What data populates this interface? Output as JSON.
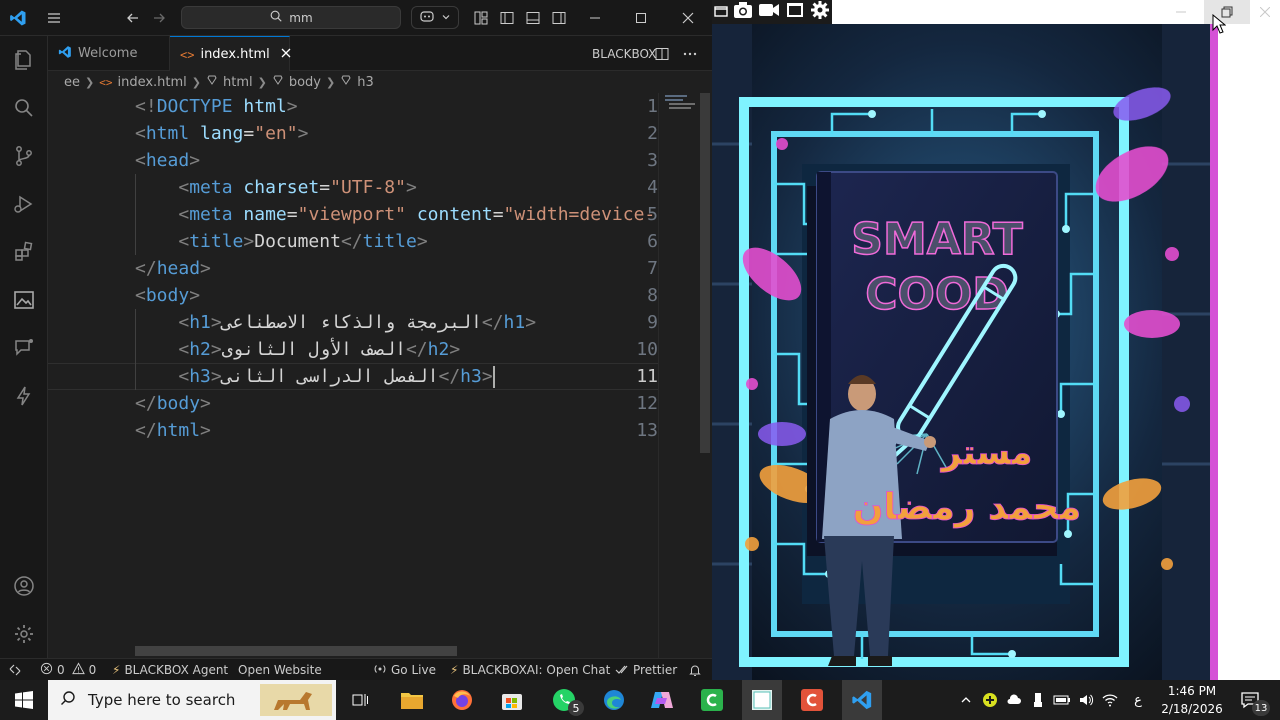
{
  "titlebar": {
    "search_text": "mm"
  },
  "tabs": [
    {
      "label": "Welcome",
      "active": false
    },
    {
      "label": "index.html",
      "active": true
    }
  ],
  "tabs_right_label": "BLACKBOX",
  "breadcrumb": {
    "items": [
      "ee",
      "index.html",
      "html",
      "body",
      "h3"
    ]
  },
  "editor": {
    "current_line": 11,
    "lines": [
      {
        "n": "1",
        "tokens": [
          [
            "br",
            "<!"
          ],
          [
            "tag",
            "DOCTYPE"
          ],
          [
            "txt",
            " "
          ],
          [
            "attr",
            "html"
          ],
          [
            "br",
            ">"
          ]
        ]
      },
      {
        "n": "2",
        "tokens": [
          [
            "br",
            "<"
          ],
          [
            "tag",
            "html"
          ],
          [
            "txt",
            " "
          ],
          [
            "attr",
            "lang"
          ],
          [
            "txt",
            "="
          ],
          [
            "str",
            "\"en\""
          ],
          [
            "br",
            ">"
          ]
        ]
      },
      {
        "n": "3",
        "tokens": [
          [
            "br",
            "<"
          ],
          [
            "tag",
            "head"
          ],
          [
            "br",
            ">"
          ]
        ]
      },
      {
        "n": "4",
        "tokens": [
          [
            "txt",
            "    "
          ],
          [
            "br",
            "<"
          ],
          [
            "tag",
            "meta"
          ],
          [
            "txt",
            " "
          ],
          [
            "attr",
            "charset"
          ],
          [
            "txt",
            "="
          ],
          [
            "str",
            "\"UTF-8\""
          ],
          [
            "br",
            ">"
          ]
        ]
      },
      {
        "n": "5",
        "tokens": [
          [
            "txt",
            "    "
          ],
          [
            "br",
            "<"
          ],
          [
            "tag",
            "meta"
          ],
          [
            "txt",
            " "
          ],
          [
            "attr",
            "name"
          ],
          [
            "txt",
            "="
          ],
          [
            "str",
            "\"viewport\""
          ],
          [
            "txt",
            " "
          ],
          [
            "attr",
            "content"
          ],
          [
            "txt",
            "="
          ],
          [
            "str",
            "\"width=device-"
          ]
        ]
      },
      {
        "n": "6",
        "tokens": [
          [
            "txt",
            "    "
          ],
          [
            "br",
            "<"
          ],
          [
            "tag",
            "title"
          ],
          [
            "br",
            ">"
          ],
          [
            "txt",
            "Document"
          ],
          [
            "br",
            "</"
          ],
          [
            "tag",
            "title"
          ],
          [
            "br",
            ">"
          ]
        ]
      },
      {
        "n": "7",
        "tokens": [
          [
            "br",
            "</"
          ],
          [
            "tag",
            "head"
          ],
          [
            "br",
            ">"
          ]
        ]
      },
      {
        "n": "8",
        "tokens": [
          [
            "br",
            "<"
          ],
          [
            "tag",
            "body"
          ],
          [
            "br",
            ">"
          ]
        ]
      },
      {
        "n": "9",
        "tokens": [
          [
            "txt",
            "    "
          ],
          [
            "br",
            "<"
          ],
          [
            "tag",
            "h1"
          ],
          [
            "br",
            ">"
          ],
          [
            "txt",
            "البرمجة والذكاء الاصطناعى"
          ],
          [
            "br",
            "</"
          ],
          [
            "tag",
            "h1"
          ],
          [
            "br",
            ">"
          ]
        ]
      },
      {
        "n": "10",
        "tokens": [
          [
            "txt",
            "    "
          ],
          [
            "br",
            "<"
          ],
          [
            "tag",
            "h2"
          ],
          [
            "br",
            ">"
          ],
          [
            "txt",
            "الصف الأول الثانوى"
          ],
          [
            "br",
            "</"
          ],
          [
            "tag",
            "h2"
          ],
          [
            "br",
            ">"
          ]
        ]
      },
      {
        "n": "11",
        "tokens": [
          [
            "txt",
            "    "
          ],
          [
            "br",
            "<"
          ],
          [
            "tag",
            "h3"
          ],
          [
            "br",
            ">"
          ],
          [
            "txt",
            "الفصل الدراسى الثانى"
          ],
          [
            "br",
            "</"
          ],
          [
            "tag",
            "h3"
          ],
          [
            "br",
            ">"
          ]
        ]
      },
      {
        "n": "12",
        "tokens": [
          [
            "br",
            "</"
          ],
          [
            "tag",
            "body"
          ],
          [
            "br",
            ">"
          ]
        ]
      },
      {
        "n": "13",
        "tokens": [
          [
            "br",
            "</"
          ],
          [
            "tag",
            "html"
          ],
          [
            "br",
            ">"
          ]
        ]
      }
    ]
  },
  "statusbar": {
    "problems": "0",
    "warnings": "0",
    "blackbox_agent": "BLACKBOX Agent",
    "open_website": "Open Website",
    "go_live": "Go Live",
    "blackboxai_chat": "BLACKBOXAI: Open Chat",
    "prettier": "Prettier"
  },
  "poster": {
    "title_line1": "SMART",
    "title_line2": "COOD",
    "arabic_line1": "مستر",
    "arabic_line2": "محمد رمضان"
  },
  "taskbar": {
    "search_placeholder": "Type here to search",
    "whatsapp_badge": "5",
    "ime_indicator": "ع",
    "time": "1:46 PM",
    "date": "2/18/2026",
    "notifications": "13"
  },
  "colors": {
    "accent": "#0078d4",
    "tag": "#569cd6",
    "attr": "#9cdcfe",
    "string": "#ce9178",
    "magenta": "#d552d6"
  }
}
